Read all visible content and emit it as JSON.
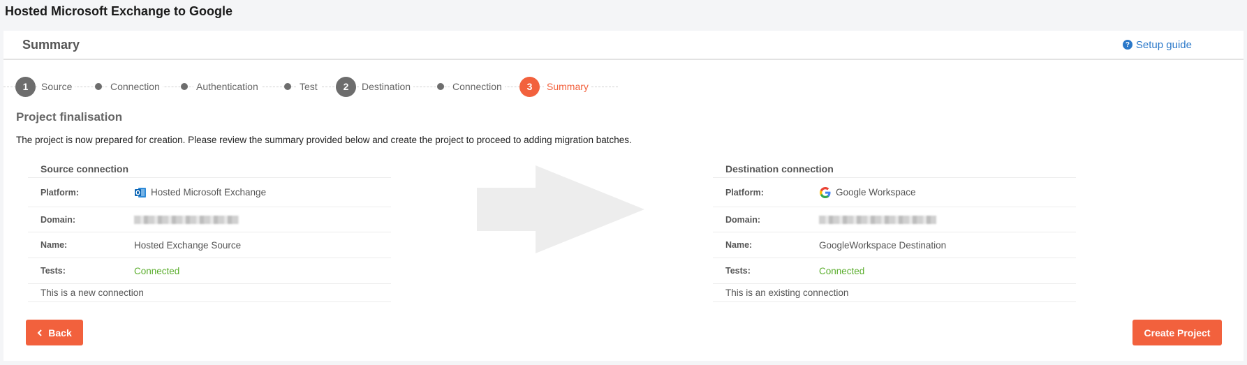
{
  "page_title": "Hosted Microsoft Exchange to Google",
  "card": {
    "title": "Summary",
    "setup_guide": "Setup guide"
  },
  "stepper": {
    "steps": [
      {
        "type": "number",
        "number": "1",
        "label": "Source"
      },
      {
        "type": "dot",
        "label": "Connection"
      },
      {
        "type": "dot",
        "label": "Authentication"
      },
      {
        "type": "dot",
        "label": "Test"
      },
      {
        "type": "number",
        "number": "2",
        "label": "Destination"
      },
      {
        "type": "dot",
        "label": "Connection"
      },
      {
        "type": "number",
        "number": "3",
        "label": "Summary",
        "active": true
      }
    ]
  },
  "section": {
    "title": "Project finalisation",
    "intro": "The project is now prepared for creation. Please review the summary provided below and create the project to proceed to adding migration batches."
  },
  "source": {
    "title": "Source connection",
    "platform_label": "Platform:",
    "platform_value": "Hosted Microsoft Exchange",
    "domain_label": "Domain:",
    "name_label": "Name:",
    "name_value": "Hosted Exchange Source",
    "tests_label": "Tests:",
    "tests_value": "Connected",
    "note": "This is a new connection",
    "icon": "outlook-icon"
  },
  "destination": {
    "title": "Destination connection",
    "platform_label": "Platform:",
    "platform_value": "Google Workspace",
    "domain_label": "Domain:",
    "name_label": "Name:",
    "name_value": "GoogleWorkspace Destination",
    "tests_label": "Tests:",
    "tests_value": "Connected",
    "note": "This is an existing connection",
    "icon": "google-icon"
  },
  "buttons": {
    "back": "Back",
    "create": "Create Project"
  },
  "colors": {
    "accent": "#f2613d",
    "link": "#2a78c9",
    "success": "#5aad2c",
    "step_inactive": "#6d6d6d"
  }
}
